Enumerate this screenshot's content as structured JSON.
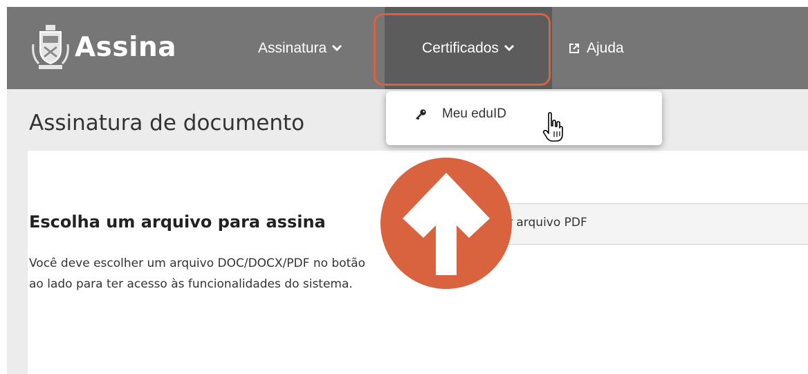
{
  "app": {
    "brand_name": "Assina"
  },
  "nav": {
    "items": [
      {
        "label": "Assinatura",
        "icon": "chevron-down-icon"
      },
      {
        "label": "Certificados",
        "icon": "chevron-down-icon",
        "active": true
      },
      {
        "label": "Ajuda",
        "icon": "external-link-icon"
      }
    ]
  },
  "dropdown": {
    "items": [
      {
        "label": "Meu eduID",
        "icon": "key-icon"
      }
    ]
  },
  "page": {
    "title": "Assinatura de documento",
    "section_title": "Escolha um arquivo para assina",
    "description": "Você deve escolher um arquivo DOC/DOCX/PDF no botão ao lado para ter acesso às funcionalidades do sistema.",
    "file_button_label": "r arquivo PDF"
  },
  "colors": {
    "navbar": "#767676",
    "navbar_active": "#5c5c5c",
    "highlight": "#d9633f",
    "arrow_circle": "#d9633f",
    "page_background": "#ececec"
  }
}
